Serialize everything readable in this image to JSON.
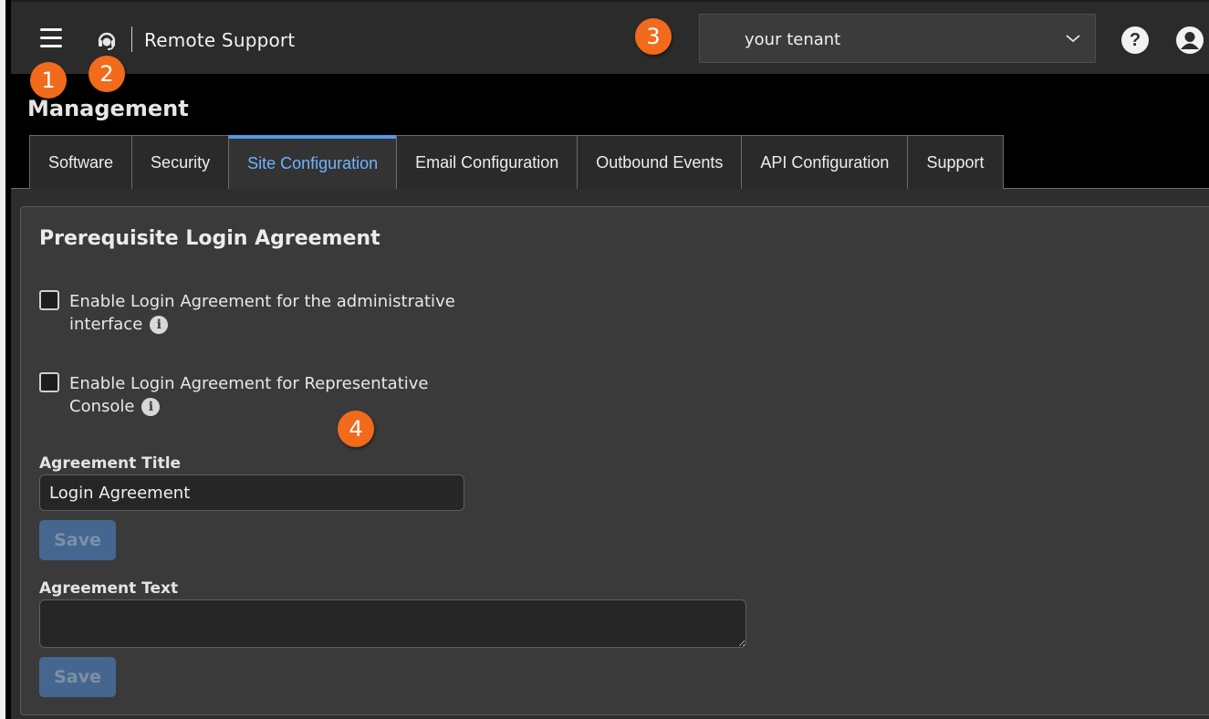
{
  "header": {
    "app_title": "Remote Support",
    "tenant_select": {
      "value": "your tenant"
    },
    "help_glyph": "?",
    "icons": [
      "hamburger-menu-icon",
      "headset-logo-icon",
      "chevron-down-icon",
      "help-icon",
      "user-account-icon"
    ]
  },
  "callouts": [
    "1",
    "2",
    "3",
    "4"
  ],
  "page": {
    "title": "Management"
  },
  "tabs": [
    {
      "label": "Software",
      "active": false
    },
    {
      "label": "Security",
      "active": false
    },
    {
      "label": "Site Configuration",
      "active": true
    },
    {
      "label": "Email Configuration",
      "active": false
    },
    {
      "label": "Outbound Events",
      "active": false
    },
    {
      "label": "API Configuration",
      "active": false
    },
    {
      "label": "Support",
      "active": false
    }
  ],
  "panel": {
    "title": "Prerequisite Login Agreement",
    "checkboxes": [
      {
        "line1": "Enable Login Agreement for the administrative",
        "line2": "interface",
        "checked": false
      },
      {
        "line1": "Enable Login Agreement for Representative",
        "line2": "Console",
        "checked": false
      }
    ],
    "info_glyph": "i",
    "agreement_title": {
      "label": "Agreement Title",
      "value": "Login Agreement",
      "save_label": "Save"
    },
    "agreement_text": {
      "label": "Agreement Text",
      "value": "",
      "save_label": "Save"
    }
  },
  "colors": {
    "accent": "#4f9be8",
    "active_tab_text": "#6fb3ff",
    "callout": "#f26a1b",
    "save_button": "#45678f",
    "topbar": "#2b2b2b"
  }
}
